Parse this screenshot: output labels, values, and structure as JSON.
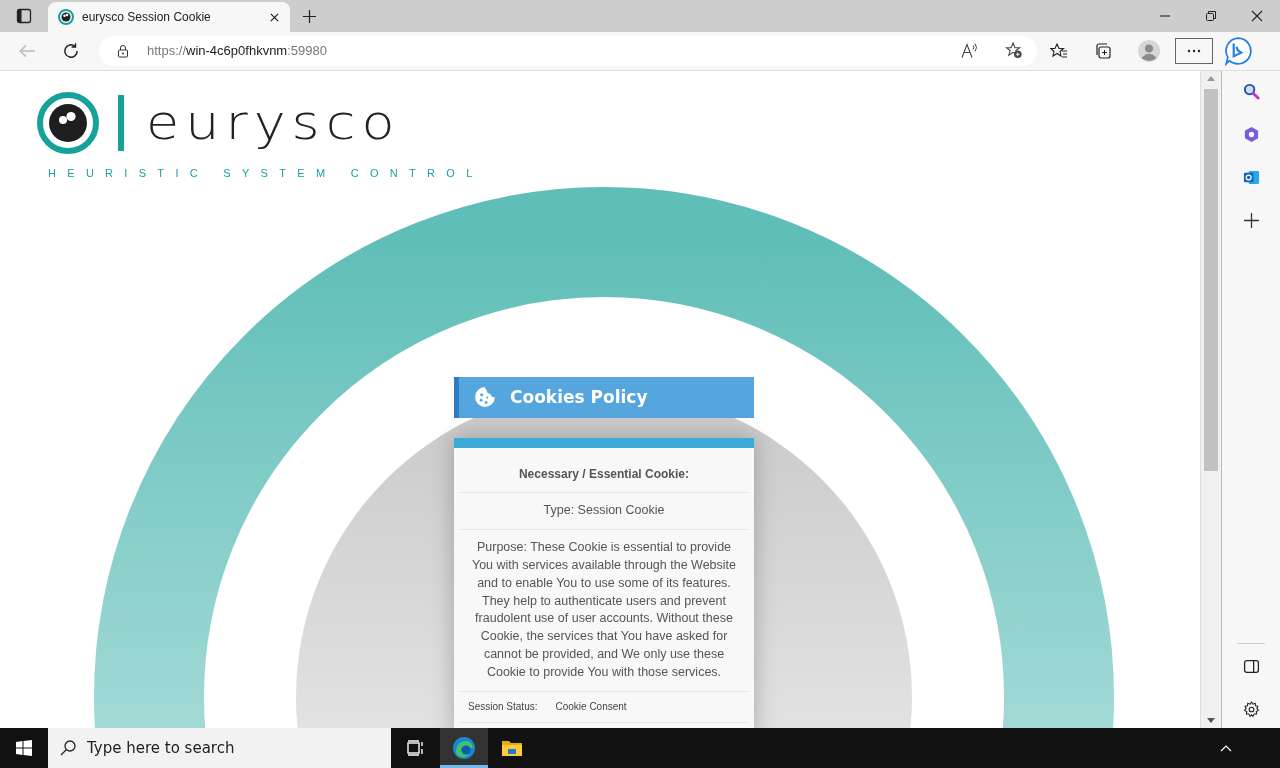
{
  "browser": {
    "tab_title": "eurysco Session Cookie",
    "url": {
      "scheme": "https://",
      "host": "win-4c6p0fhkvnm",
      "port": ":59980"
    }
  },
  "page": {
    "logo": {
      "wordmark": "eurysco",
      "tagline": "HEURISTIC SYSTEM CONTROL"
    },
    "panel": {
      "title": "Cookies Policy",
      "heading": "Necessary / Essential Cookie:",
      "type": "Type: Session Cookie",
      "purpose": "Purpose: These Cookie is essential to provide You with services available through the Website and to enable You to use some of its features. They help to authenticate users and prevent fraudolent use of user accounts. Without these Cookie, the services that You have asked for cannot be provided, and We only use these Cookie to provide You with those services.",
      "status_label": "Session Status:",
      "status_value": "Cookie Consent"
    }
  },
  "taskbar": {
    "search_placeholder": "Type here to search",
    "apps": [
      {
        "kind": "edge",
        "running": true
      },
      {
        "kind": "explorer",
        "running": false
      }
    ]
  }
}
